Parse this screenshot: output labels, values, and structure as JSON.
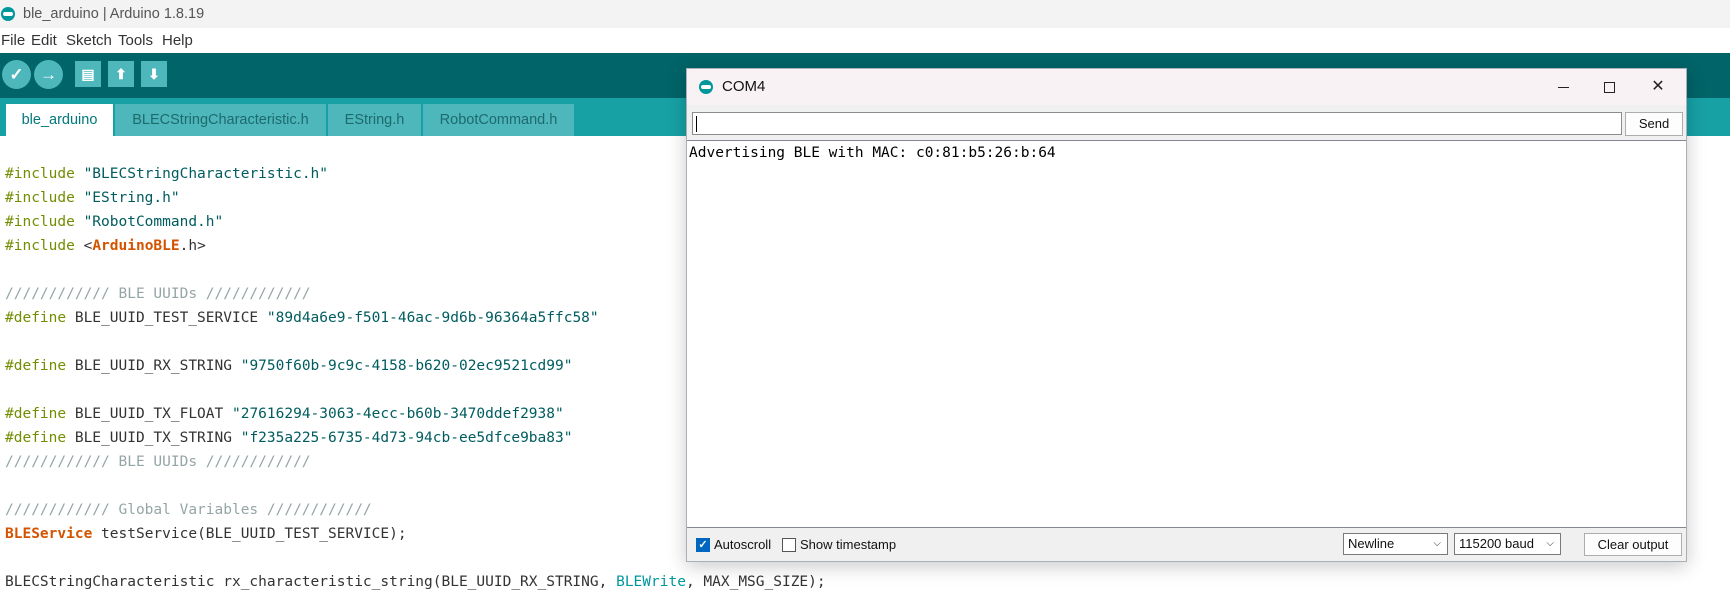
{
  "window": {
    "title": "ble_arduino | Arduino 1.8.19"
  },
  "menu": [
    "File",
    "Edit",
    "Sketch",
    "Tools",
    "Help"
  ],
  "toolbar": {
    "verify": "✓",
    "upload": "→",
    "new": "▤",
    "open": "⬆",
    "save": "⬇"
  },
  "tabs": [
    "ble_arduino",
    "BLECStringCharacteristic.h",
    "EString.h",
    "RobotCommand.h"
  ],
  "code": [
    {
      "directive": "#include",
      "string": " \"BLECStringCharacteristic.h\""
    },
    {
      "directive": "#include",
      "string": " \"EString.h\""
    },
    {
      "directive": "#include",
      "string": " \"RobotCommand.h\""
    },
    {
      "directive": "#include",
      "lt": " <",
      "type": "ArduinoBLE",
      "rest": ".h>"
    },
    {
      "comment": "//////////// BLE UUIDs ////////////"
    },
    {
      "directive": "#define",
      "name": " BLE_UUID_TEST_SERVICE ",
      "string": "\"89d4a6e9-f501-46ac-9d6b-96364a5ffc58\""
    },
    {
      "directive": "#define",
      "name": " BLE_UUID_RX_STRING ",
      "string": "\"9750f60b-9c9c-4158-b620-02ec9521cd99\""
    },
    {
      "directive": "#define",
      "name": " BLE_UUID_TX_FLOAT ",
      "string": "\"27616294-3063-4ecc-b60b-3470ddef2938\""
    },
    {
      "directive": "#define",
      "name": " BLE_UUID_TX_STRING ",
      "string": "\"f235a225-6735-4d73-94cb-ee5dfce9ba83\""
    },
    {
      "comment": "//////////// BLE UUIDs ////////////"
    },
    {
      "comment": "//////////// Global Variables ////////////"
    },
    {
      "type": "BLEService",
      "rest": " testService(BLE_UUID_TEST_SERVICE);"
    },
    {
      "before": "BLECStringCharacteristic rx_characteristic_string(BLE_UUID_RX_STRING, ",
      "const": "BLEWrite",
      "after": ", MAX_MSG_SIZE);"
    }
  ],
  "serial_monitor": {
    "title": "COM4",
    "controls": {
      "close": "✕"
    },
    "input_value": "",
    "send_label": "Send",
    "output": "Advertising BLE with MAC: c0:81:b5:26:b:64",
    "autoscroll_label": "Autoscroll",
    "autoscroll_checked": true,
    "autoscroll_mark": "✓",
    "timestamp_label": "Show timestamp",
    "timestamp_checked": false,
    "line_ending": "Newline",
    "baud": "115200 baud",
    "clear_label": "Clear output"
  }
}
